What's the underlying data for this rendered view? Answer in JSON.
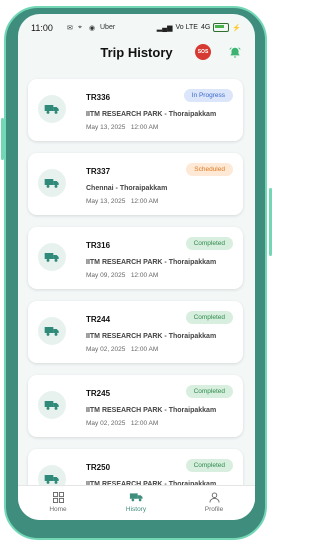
{
  "status_bar": {
    "time": "11:00",
    "carrier": "Uber",
    "network": "Vo LTE",
    "signal": "4G",
    "battery_icon": "battery-icon"
  },
  "header": {
    "title": "Trip History",
    "sos_label": "SOS",
    "bell_icon": "bell-icon"
  },
  "trips": [
    {
      "id": "TR336",
      "route": "IITM RESEARCH PARK - Thoraipakkam",
      "date": "May 13, 2025",
      "time": "12:00 AM",
      "status": "In Progress",
      "status_kind": "inprog"
    },
    {
      "id": "TR337",
      "route": "Chennai - Thoraipakkam",
      "date": "May 13, 2025",
      "time": "12:00 AM",
      "status": "Scheduled",
      "status_kind": "sched"
    },
    {
      "id": "TR316",
      "route": "IITM RESEARCH PARK - Thoraipakkam",
      "date": "May 09, 2025",
      "time": "12:00 AM",
      "status": "Completed",
      "status_kind": "done"
    },
    {
      "id": "TR244",
      "route": "IITM RESEARCH PARK - Thoraipakkam",
      "date": "May 02, 2025",
      "time": "12:00 AM",
      "status": "Completed",
      "status_kind": "done"
    },
    {
      "id": "TR245",
      "route": "IITM RESEARCH PARK - Thoraipakkam",
      "date": "May 02, 2025",
      "time": "12:00 AM",
      "status": "Completed",
      "status_kind": "done"
    },
    {
      "id": "TR250",
      "route": "IITM RESEARCH PARK - Thoraipakkam",
      "date": "",
      "time": "",
      "status": "Completed",
      "status_kind": "done"
    }
  ],
  "tabs": [
    {
      "label": "Home",
      "icon": "grid-icon",
      "active": false
    },
    {
      "label": "History",
      "icon": "truck-icon",
      "active": true
    },
    {
      "label": "Profile",
      "icon": "person-icon",
      "active": false
    }
  ],
  "colors": {
    "accent": "#3f8d7d",
    "frame": "#73d7b6"
  }
}
